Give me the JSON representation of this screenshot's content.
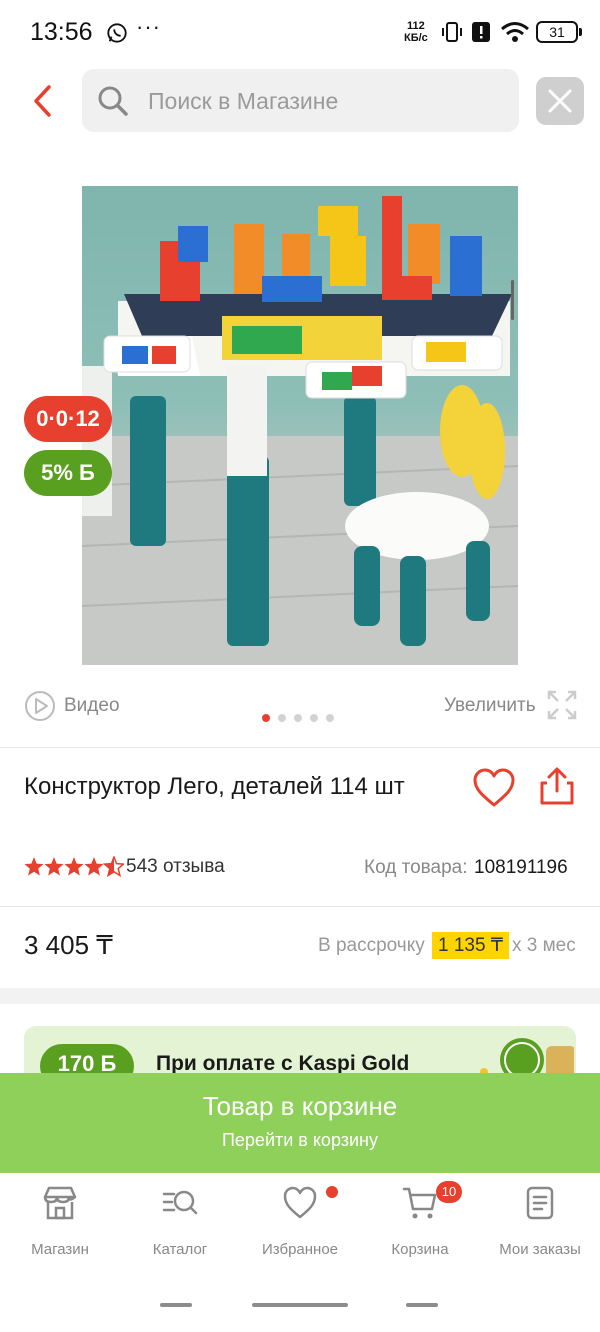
{
  "status_bar": {
    "time": "13:56",
    "dots": "···",
    "speed_line1": "112",
    "speed_line2": "КБ/с",
    "battery": "31"
  },
  "header": {
    "search_placeholder": "Поиск в Магазине"
  },
  "product": {
    "badges": {
      "installment": "0·0·12",
      "bonus": "5% Б"
    },
    "media": {
      "video_label": "Видео",
      "zoom_label": "Увеличить",
      "image_count": 5,
      "active_image": 1
    },
    "title": "Конструктор Лего, деталей 114 шт",
    "rating": 4.5,
    "review_count": "543 отзыва",
    "code_label": "Код товара:",
    "code_value": "108191196",
    "price": "3 405 ₸",
    "installment": {
      "label": "В рассрочку",
      "amount": "1 135 ₸",
      "months": "х 3 мес"
    }
  },
  "promo": {
    "badge": "170 Б",
    "text": "При оплате с Kaspi Gold"
  },
  "cart_banner": {
    "title": "Товар в корзине",
    "link": "Перейти в корзину"
  },
  "bottom_nav": {
    "items": [
      {
        "label": "Магазин",
        "icon": "shop-icon"
      },
      {
        "label": "Каталог",
        "icon": "catalog-icon"
      },
      {
        "label": "Избранное",
        "icon": "heart-icon"
      },
      {
        "label": "Корзина",
        "icon": "cart-icon",
        "badge": "10"
      },
      {
        "label": "Мои заказы",
        "icon": "orders-icon"
      }
    ]
  },
  "colors": {
    "accent_red": "#e8402f",
    "kaspi_green": "#5aa020",
    "cart_green": "#8fd05a",
    "installment_yellow": "#ffd400"
  }
}
